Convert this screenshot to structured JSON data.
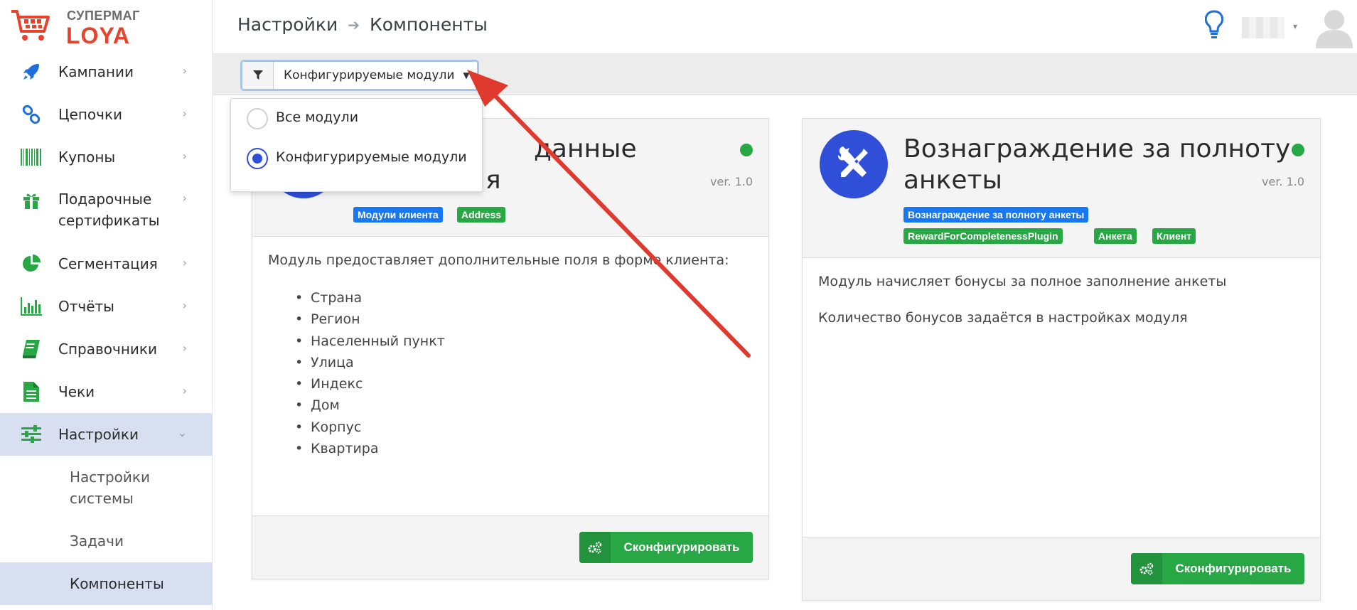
{
  "logo": {
    "line1": "СУПЕРМАГ",
    "line2": "LOYA"
  },
  "colors": {
    "accent": "#2f4fd8",
    "success": "#28a745",
    "brand_red": "#e8412c",
    "active_bg": "#d7dff0"
  },
  "sidebar": {
    "items": [
      {
        "label": "Кампании",
        "icon": "rocket-icon"
      },
      {
        "label": "Цепочки",
        "icon": "chain-icon"
      },
      {
        "label": "Купоны",
        "icon": "barcode-icon"
      },
      {
        "label": "Подарочные",
        "label2": "сертификаты",
        "icon": "gift-icon"
      },
      {
        "label": "Сегментация",
        "icon": "pie-chart-icon"
      },
      {
        "label": "Отчёты",
        "icon": "bar-chart-icon"
      },
      {
        "label": "Справочники",
        "icon": "book-icon"
      },
      {
        "label": "Чеки",
        "icon": "receipt-icon"
      },
      {
        "label": "Настройки",
        "icon": "sliders-icon"
      }
    ],
    "subitems": [
      {
        "label": "Настройки",
        "label2": "системы"
      },
      {
        "label": "Задачи"
      },
      {
        "label": "Компоненты"
      }
    ]
  },
  "header": {
    "breadcrumb": [
      "Настройки",
      "Компоненты"
    ]
  },
  "toolbar": {
    "filter_value": "Конфигурируемые модули"
  },
  "dropdown": {
    "options": [
      "Все модули",
      "Конфигурируемые модули"
    ],
    "selected": 1
  },
  "cards": [
    {
      "title_line1": "данные",
      "title_line2": "я",
      "version": "ver. 1.0",
      "tags": [
        "Модули клиента",
        "Address"
      ],
      "description": "Модуль предоставляет дополнительные поля в форме клиента:",
      "fields": [
        "Страна",
        "Регион",
        "Населенный пункт",
        "Улица",
        "Индекс",
        "Дом",
        "Корпус",
        "Квартира"
      ],
      "button": "Сконфигурировать"
    },
    {
      "title_line1": "Вознаграждение за полноту",
      "title_line2": "анкеты",
      "version": "ver. 1.0",
      "tags": [
        "Вознаграждение за полноту анкеты",
        "RewardForCompletenessPlugin",
        "Анкета",
        "Клиент"
      ],
      "paragraphs": [
        "Модуль начисляет бонусы за полное заполнение анкеты",
        "Количество бонусов задаётся в настройках модуля"
      ],
      "button": "Сконфигурировать"
    }
  ]
}
